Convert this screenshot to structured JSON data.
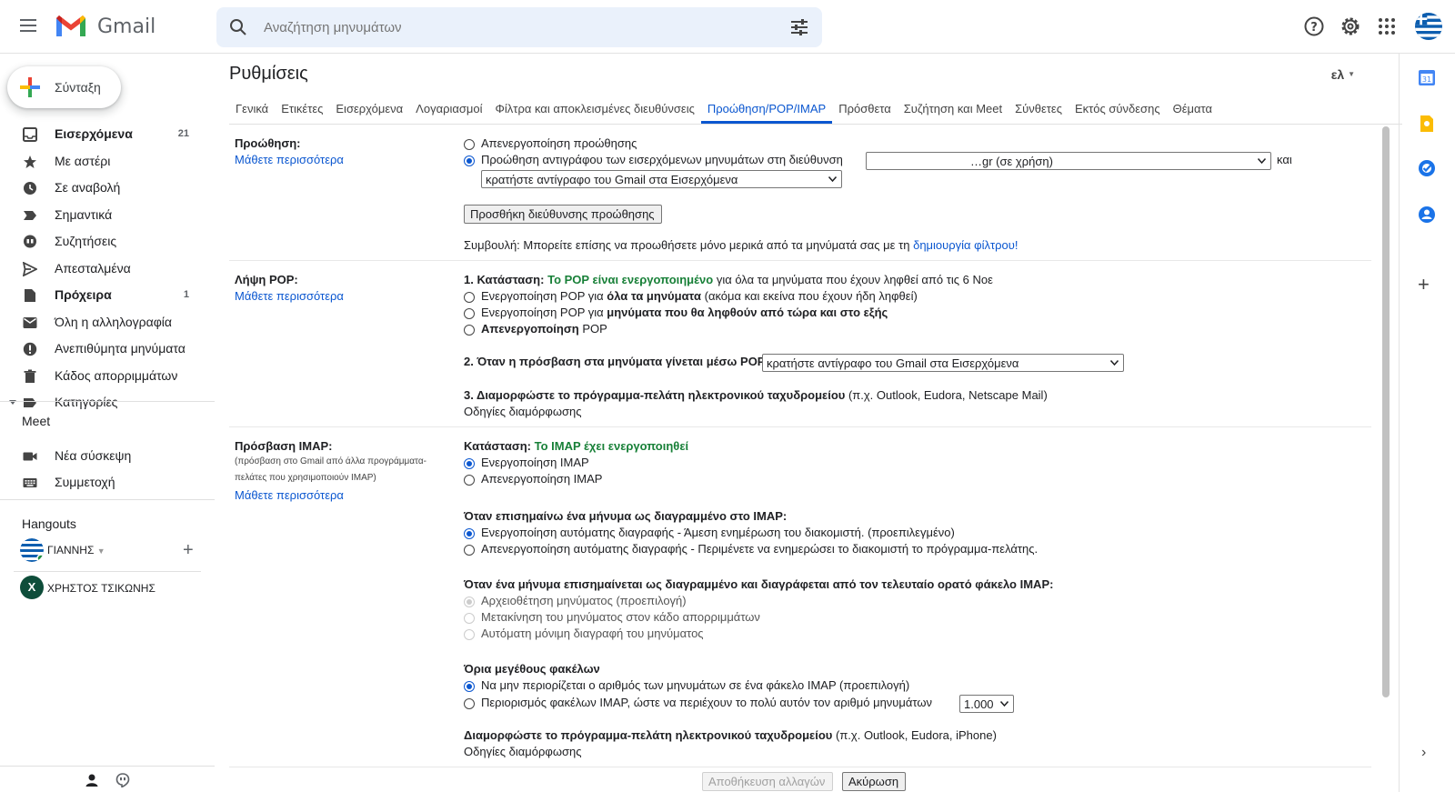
{
  "app": {
    "name": "Gmail"
  },
  "search": {
    "placeholder": "Αναζήτηση μηνυμάτων"
  },
  "compose": {
    "label": "Σύνταξη"
  },
  "sidebar": {
    "items": [
      {
        "label": "Εισερχόμενα",
        "count": "21",
        "icon": "inbox-icon",
        "bold": true
      },
      {
        "label": "Με αστέρι",
        "count": "",
        "icon": "star-icon"
      },
      {
        "label": "Σε αναβολή",
        "count": "",
        "icon": "clock-icon"
      },
      {
        "label": "Σημαντικά",
        "count": "",
        "icon": "label-important-icon"
      },
      {
        "label": "Συζητήσεις",
        "count": "",
        "icon": "chat-icon"
      },
      {
        "label": "Απεσταλμένα",
        "count": "",
        "icon": "send-icon"
      },
      {
        "label": "Πρόχειρα",
        "count": "1",
        "icon": "draft-icon",
        "bold": true
      },
      {
        "label": "Όλη η αλληλογραφία",
        "count": "",
        "icon": "mail-icon"
      },
      {
        "label": "Ανεπιθύμητα μηνύματα",
        "count": "",
        "icon": "spam-icon"
      },
      {
        "label": "Κάδος απορριμμάτων",
        "count": "",
        "icon": "trash-icon"
      },
      {
        "label": "Κατηγορίες",
        "count": "",
        "icon": "label-icon"
      }
    ],
    "meet": {
      "title": "Meet",
      "new_meeting": "Νέα σύσκεψη",
      "join": "Συμμετοχή"
    },
    "hangouts": {
      "title": "Hangouts",
      "user": "ΓΙΑΝΝΗΣ",
      "contact": "ΧΡΗΣΤΟΣ ΤΣΙΚΩΝΗΣ",
      "contact_initial": "X"
    }
  },
  "settings": {
    "title": "Ρυθμίσεις",
    "lang": "ελ",
    "tabs": [
      "Γενικά",
      "Ετικέτες",
      "Εισερχόμενα",
      "Λογαριασμοί",
      "Φίλτρα και αποκλεισμένες διευθύνσεις",
      "Προώθηση/POP/IMAP",
      "Πρόσθετα",
      "Συζήτηση και Meet",
      "Σύνθετες",
      "Εκτός σύνδεσης",
      "Θέματα"
    ],
    "forwarding": {
      "label": "Προώθηση:",
      "learn_more": "Μάθετε περισσότερα",
      "opt_disable": "Απενεργοποίηση προώθησης",
      "opt_forward": "Προώθηση αντιγράφου των εισερχόμενων μηνυμάτων στη διεύθυνση",
      "address_value": "…gr (σε χρήση)",
      "and": "και",
      "keep_value": "κρατήστε αντίγραφο του Gmail στα Εισερχόμενα",
      "add_button": "Προσθήκη διεύθυνσης προώθησης",
      "tip_prefix": "Συμβουλή: Μπορείτε επίσης να προωθήσετε μόνο μερικά από τα μηνύματά σας με τη",
      "tip_link": "δημιουργία φίλτρου!"
    },
    "pop": {
      "label": "Λήψη POP:",
      "learn_more": "Μάθετε περισσότερα",
      "status_prefix": "1. Κατάσταση:",
      "status_value": "Το POP είναι ενεργοποιημένο",
      "status_suffix": "για όλα τα μηνύματα που έχουν ληφθεί από τις 6 Νοε",
      "opt_all_a": "Ενεργοποίηση POP για",
      "opt_all_b": "όλα τα μηνύματα",
      "opt_all_c": "(ακόμα και εκείνα που έχουν ήδη ληφθεί)",
      "opt_now_a": "Ενεργοποίηση POP για",
      "opt_now_b": "μηνύματα που θα ληφθούν από τώρα και στο εξής",
      "opt_off_a": "Απενεργοποίηση",
      "opt_off_b": "POP",
      "when_label": "2. Όταν η πρόσβαση στα μηνύματα γίνεται μέσω POP",
      "when_value": "κρατήστε αντίγραφο του Gmail στα Εισερχόμενα",
      "config_label": "3. Διαμορφώστε το πρόγραμμα-πελάτη ηλεκτρονικού ταχυδρομείου",
      "config_suffix": "(π.χ. Outlook, Eudora, Netscape Mail)",
      "config_link": "Οδηγίες διαμόρφωσης"
    },
    "imap": {
      "label": "Πρόσβαση IMAP:",
      "desc1": "(πρόσβαση στο Gmail από άλλα προγράμματα-",
      "desc2": "πελάτες που χρησιμοποιούν IMAP)",
      "learn_more": "Μάθετε περισσότερα",
      "status_prefix": "Κατάσταση:",
      "status_value": "Το IMAP έχει ενεργοποιηθεί",
      "opt_enable": "Ενεργοποίηση IMAP",
      "opt_disable": "Απενεργοποίηση IMAP",
      "deleted_title": "Όταν επισημαίνω ένα μήνυμα ως διαγραμμένο στο IMAP:",
      "auto_on": "Ενεργοποίηση αυτόματης διαγραφής - Άμεση ενημέρωση του διακομιστή. (προεπιλεγμένο)",
      "auto_off": "Απενεργοποίηση αυτόματης διαγραφής - Περιμένετε να ενημερώσει το διακομιστή το πρόγραμμα-πελάτης.",
      "expunge_title": "Όταν ένα μήνυμα επισημαίνεται ως διαγραμμένο και διαγράφεται από τον τελευταίο ορατό φάκελο IMAP:",
      "archive": "Αρχειοθέτηση μηνύματος (προεπιλογή)",
      "trash": "Μετακίνηση του μηνύματος στον κάδο απορριμμάτων",
      "delete_forever": "Αυτόματη μόνιμη διαγραφή του μηνύματος",
      "folder_title": "Όρια μεγέθους φακέλων",
      "no_limit": "Να μην περιορίζεται ο αριθμός των μηνυμάτων σε ένα φάκελο IMAP (προεπιλογή)",
      "limit": "Περιορισμός φακέλων IMAP, ώστε να περιέχουν το πολύ αυτόν τον αριθμό μηνυμάτων",
      "limit_value": "1.000",
      "config_label": "Διαμορφώστε το πρόγραμμα-πελάτη ηλεκτρονικού ταχυδρομείου",
      "config_suffix": "(π.χ. Outlook, Eudora, iPhone)",
      "config_link": "Οδηγίες διαμόρφωσης"
    },
    "footer": {
      "save": "Αποθήκευση αλλαγών",
      "cancel": "Ακύρωση"
    }
  },
  "colors": {
    "accent": "#0b57d0",
    "green": "#188038"
  }
}
